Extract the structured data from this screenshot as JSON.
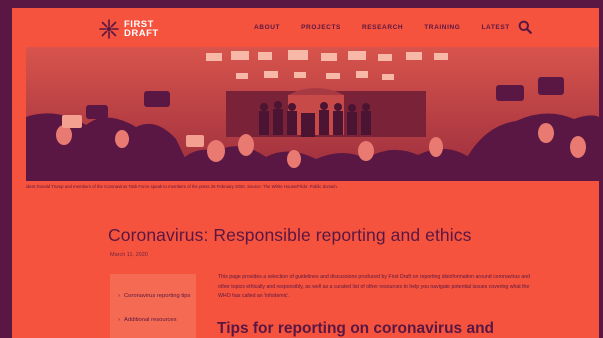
{
  "site": {
    "logo_line1": "FIRST",
    "logo_line2": "DRAFT"
  },
  "nav": {
    "items": [
      "ABOUT",
      "PROJECTS",
      "RESEARCH",
      "TRAINING",
      "LATEST"
    ]
  },
  "hero": {
    "caption": "ident Donald Trump and members of the Coronavirus Task Force speak to members of the press 26 February 2020. Source: The White House/Flickr. Public domain."
  },
  "article": {
    "title": "Coronavirus: Responsible reporting and ethics",
    "date": "March 11, 2020",
    "toc": [
      "Coronavirus reporting tips",
      "Additional resources"
    ],
    "intro": "This page provides a selection of guidelines and discussions produced by First Draft on reporting disinformation around coronavirus and other topics ethically and responsibly, as well as a curated list of other resources to help you navigate potential issues covering what the WHO has called an 'infodemic'.",
    "heading": "Tips for reporting on coronavirus and"
  },
  "colors": {
    "background": "#5a1743",
    "brand": "#f5533d",
    "text": "#5a1743",
    "logo_text": "#ffffff"
  }
}
